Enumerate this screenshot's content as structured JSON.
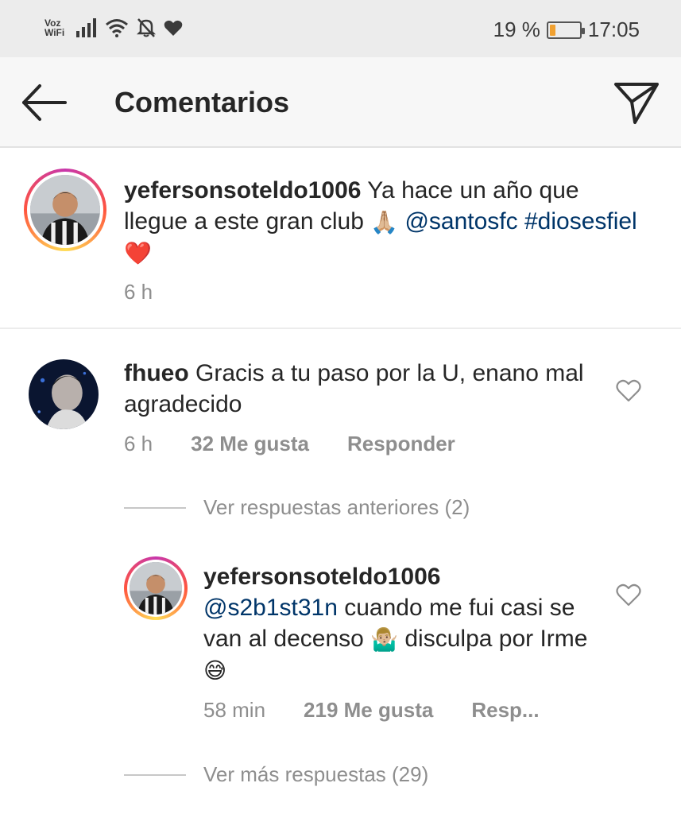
{
  "status_bar": {
    "vowifi_top": "Voz",
    "vowifi_bottom": "WiFi",
    "battery_text": "19 %",
    "battery_level": 0.19,
    "time": "17:05"
  },
  "header": {
    "title": "Comentarios",
    "back_icon": "arrow-left-icon",
    "send_icon": "paper-plane-icon"
  },
  "caption": {
    "username": "yefersonsoteldo1006",
    "text_1": " Ya hace un año que llegue a este gran club ",
    "emoji_1": "🙏🏼",
    "mention": "@santosfc",
    "hashtag": "#diosesfiel",
    "emoji_2": "❤️",
    "time": "6 h"
  },
  "comments": [
    {
      "username": "fhueo",
      "text": " Gracis a tu paso por la U, enano mal agradecido",
      "time": "6 h",
      "likes": "32 Me gusta",
      "reply_label": "Responder",
      "previous_replies": "Ver respuestas anteriores (2)",
      "replies": [
        {
          "username": "yefersonsoteldo1006",
          "mention": "@s2b1st31n",
          "text_1": " cuando me fui casi se van al decenso ",
          "emoji_1": "🤷🏼‍♂️",
          "text_2": " disculpa por Irme ",
          "emoji_2": "😅",
          "time": "58 min",
          "likes": "219 Me gusta",
          "reply_label": "Resp..."
        }
      ],
      "more_replies": "Ver más respuestas (29)"
    }
  ],
  "colors": {
    "link": "#003569",
    "muted": "#8e8e8e",
    "text": "#262626"
  }
}
